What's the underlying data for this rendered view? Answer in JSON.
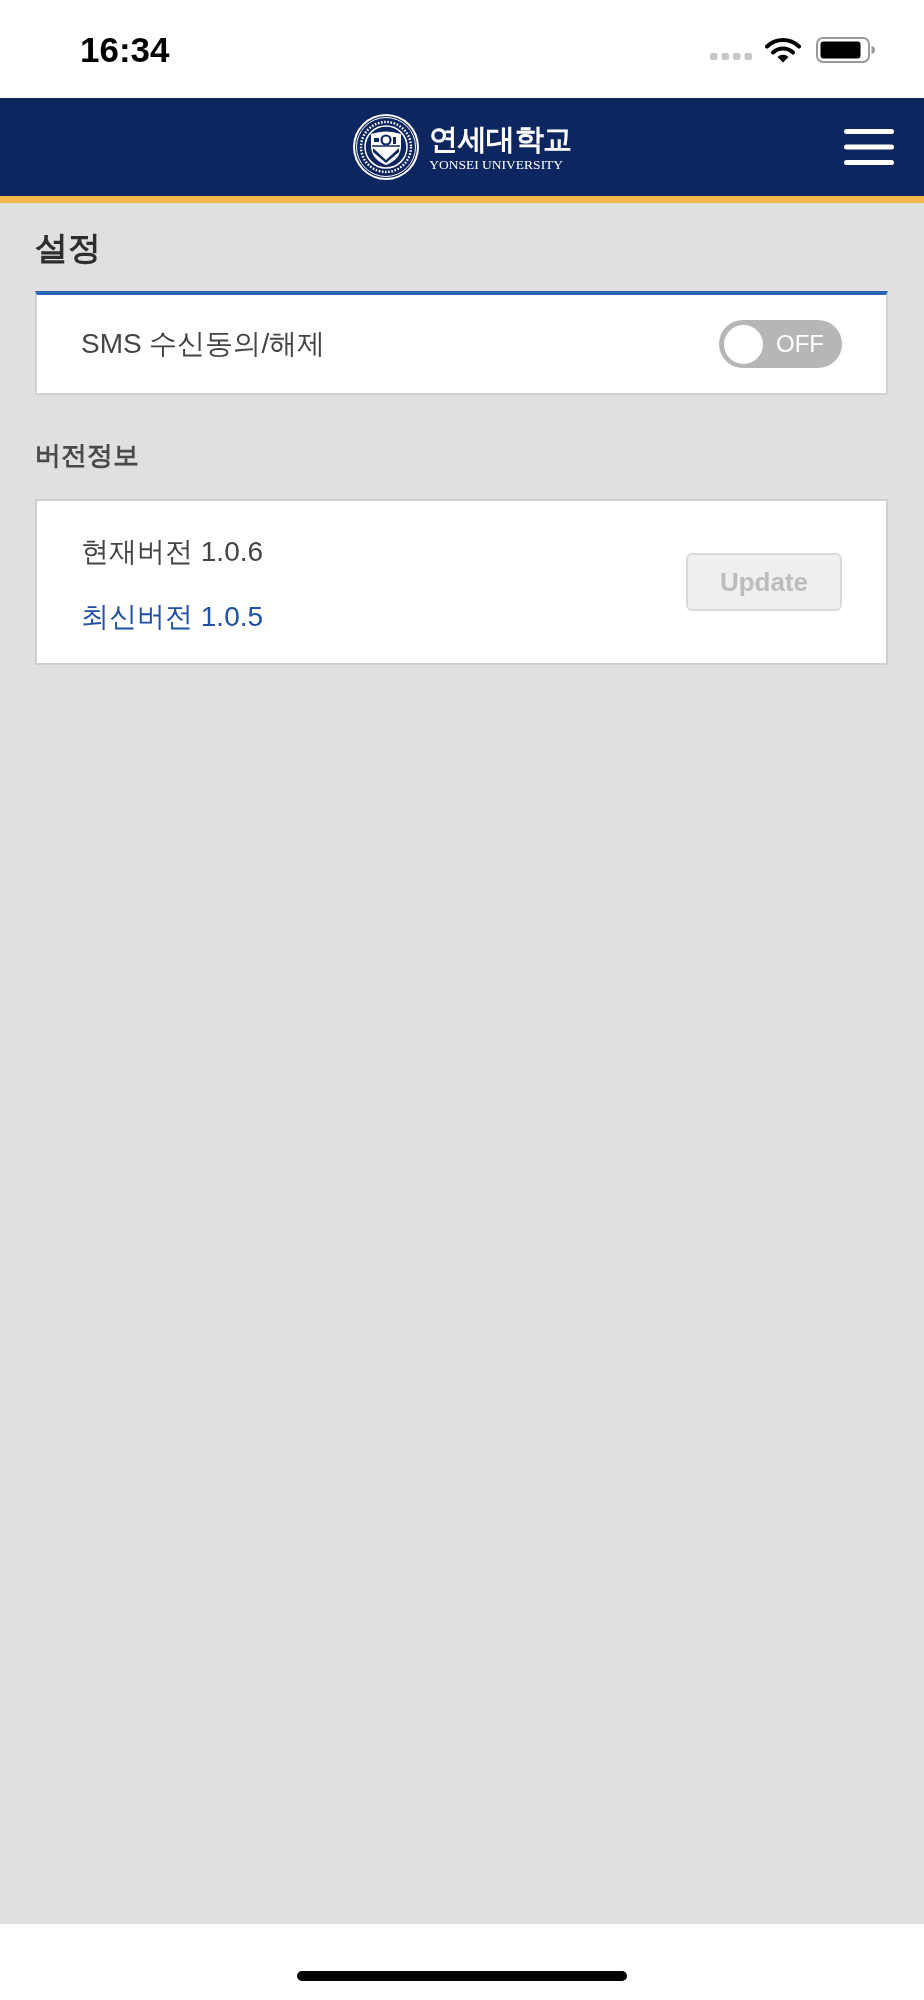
{
  "status_bar": {
    "time": "16:34"
  },
  "header": {
    "logo_title": "연세대학교",
    "logo_subtitle": "YONSEI UNIVERSITY"
  },
  "page_title": "설정",
  "settings": [
    {
      "kind": "toggle",
      "label": "SMS 수신동의/해제",
      "on": false,
      "state_label": "OFF"
    }
  ],
  "version_section": {
    "title": "버전정보",
    "current": "현재버전 1.0.6",
    "latest": "최신버전 1.0.5",
    "update_button": {
      "label": "Update",
      "disabled": true
    }
  }
}
